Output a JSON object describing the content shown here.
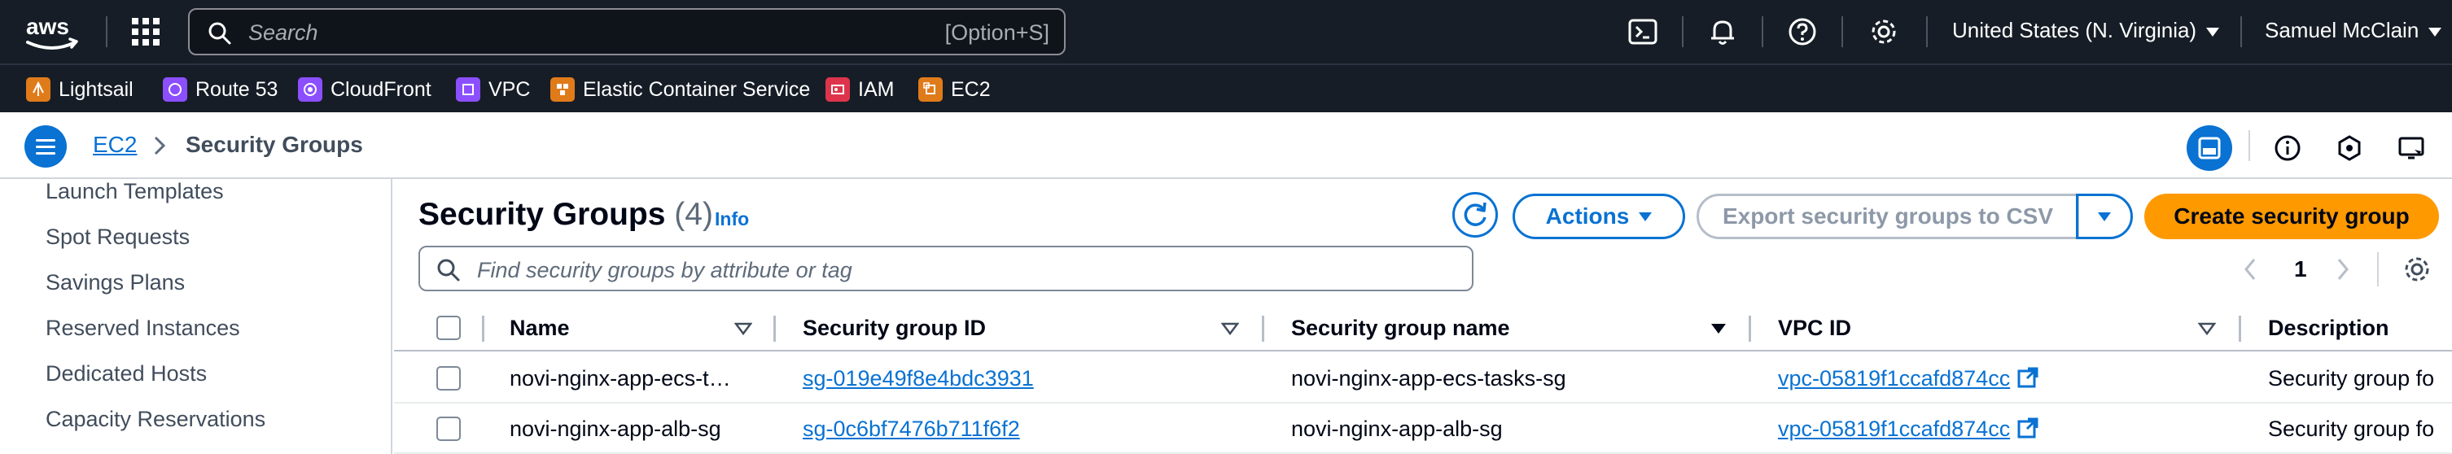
{
  "topnav": {
    "logo_text": "aws",
    "search_placeholder": "Search",
    "search_shortcut": "[Option+S]",
    "region": "United States (N. Virginia)",
    "user": "Samuel McClain",
    "icons": [
      "cloudshell-icon",
      "bell-icon",
      "help-icon",
      "settings-icon"
    ]
  },
  "favorites": [
    {
      "label": "Lightsail",
      "color": "#e07b1a"
    },
    {
      "label": "Route 53",
      "color": "#8c4fff"
    },
    {
      "label": "CloudFront",
      "color": "#8c4fff"
    },
    {
      "label": "VPC",
      "color": "#8c4fff"
    },
    {
      "label": "Elastic Container Service",
      "color": "#e07b1a"
    },
    {
      "label": "IAM",
      "color": "#dd344c"
    },
    {
      "label": "EC2",
      "color": "#e07b1a"
    }
  ],
  "breadcrumb": {
    "parent": "EC2",
    "current": "Security Groups"
  },
  "sidebar": {
    "items": [
      "Launch Templates",
      "Spot Requests",
      "Savings Plans",
      "Reserved Instances",
      "Dedicated Hosts",
      "Capacity Reservations"
    ]
  },
  "main": {
    "title": "Security Groups",
    "count": "(4)",
    "info": "Info",
    "actions_label": "Actions",
    "export_label": "Export security groups to CSV",
    "create_label": "Create security group",
    "filter_placeholder": "Find security groups by attribute or tag",
    "page": "1"
  },
  "table": {
    "columns": [
      "Name",
      "Security group ID",
      "Security group name",
      "VPC ID",
      "Description"
    ],
    "rows": [
      {
        "name": "novi-nginx-app-ecs-t…",
        "sg_id": "sg-019e49f8e4bdc3931",
        "sg_name": "novi-nginx-app-ecs-tasks-sg",
        "vpc_id": "vpc-05819f1ccafd874cc",
        "description": "Security group fo"
      },
      {
        "name": "novi-nginx-app-alb-sg",
        "sg_id": "sg-0c6bf7476b711f6f2",
        "sg_name": "novi-nginx-app-alb-sg",
        "vpc_id": "vpc-05819f1ccafd874cc",
        "description": "Security group fo"
      }
    ]
  },
  "colors": {
    "nav_bg": "#161d26",
    "link": "#0972d3",
    "primary_button": "#ff9900"
  }
}
